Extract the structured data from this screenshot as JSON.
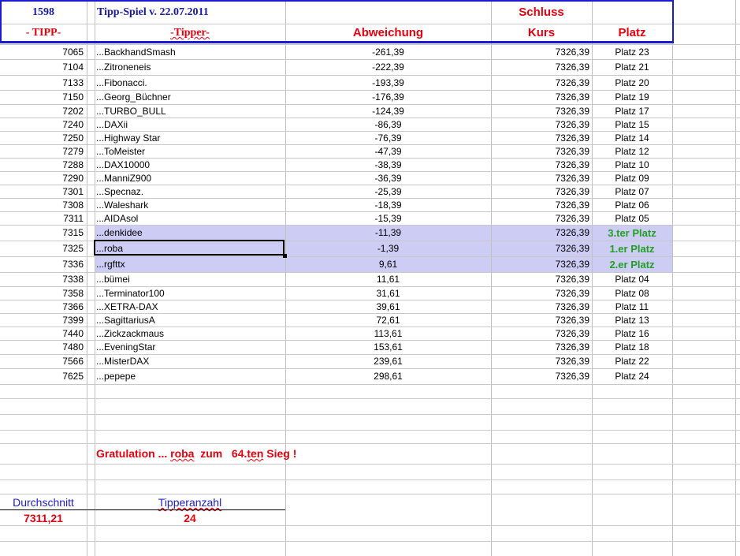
{
  "header": {
    "count": "1598",
    "title": "Tipp-Spiel v. 22.07.2011",
    "schluss": "Schluss",
    "col_tipp": "- TIPP-",
    "col_tipper": "-Tipper-",
    "col_abweichung": "Abweichung",
    "col_kurs": "Kurs",
    "col_platz": "Platz"
  },
  "rows": [
    {
      "tipp": "7065",
      "tipper": "...BackhandSmash",
      "abw": "-261,39",
      "kurs": "7326,39",
      "platz": "Platz 23"
    },
    {
      "tipp": "7104",
      "tipper": "...Zitroneneis",
      "abw": "-222,39",
      "kurs": "7326,39",
      "platz": "Platz 21"
    },
    {
      "tipp": "7133",
      "tipper": "...Fibonacci.",
      "abw": "-193,39",
      "kurs": "7326,39",
      "platz": "Platz 20"
    },
    {
      "tipp": "7150",
      "tipper": "...Georg_Büchner",
      "abw": "-176,39",
      "kurs": "7326,39",
      "platz": "Platz 19"
    },
    {
      "tipp": "7202",
      "tipper": "...TURBO_BULL",
      "abw": "-124,39",
      "kurs": "7326,39",
      "platz": "Platz 17"
    },
    {
      "tipp": "7240",
      "tipper": "...DAXii",
      "abw": "-86,39",
      "kurs": "7326,39",
      "platz": "Platz 15"
    },
    {
      "tipp": "7250",
      "tipper": "...Highway Star",
      "abw": "-76,39",
      "kurs": "7326,39",
      "platz": "Platz 14"
    },
    {
      "tipp": "7279",
      "tipper": "...ToMeister",
      "abw": "-47,39",
      "kurs": "7326,39",
      "platz": "Platz 12"
    },
    {
      "tipp": "7288",
      "tipper": "...DAX10000",
      "abw": "-38,39",
      "kurs": "7326,39",
      "platz": "Platz 10"
    },
    {
      "tipp": "7290",
      "tipper": "...ManniZ900",
      "abw": "-36,39",
      "kurs": "7326,39",
      "platz": "Platz 09"
    },
    {
      "tipp": "7301",
      "tipper": "...Specnaz.",
      "abw": "-25,39",
      "kurs": "7326,39",
      "platz": "Platz 07"
    },
    {
      "tipp": "7308",
      "tipper": "...Waleshark",
      "abw": "-18,39",
      "kurs": "7326,39",
      "platz": "Platz 06"
    },
    {
      "tipp": "7311",
      "tipper": "...AIDAsol",
      "abw": "-15,39",
      "kurs": "7326,39",
      "platz": "Platz 05"
    },
    {
      "tipp": "7315",
      "tipper": "...denkidee",
      "abw": "-11,39",
      "kurs": "7326,39",
      "platz": "3.ter Platz",
      "winner": true
    },
    {
      "tipp": "7325",
      "tipper": "...roba",
      "abw": "-1,39",
      "kurs": "7326,39",
      "platz": "1.er Platz",
      "winner": true
    },
    {
      "tipp": "7336",
      "tipper": "...rgfttx",
      "abw": "9,61",
      "kurs": "7326,39",
      "platz": "2.er Platz",
      "winner": true
    },
    {
      "tipp": "7338",
      "tipper": "...bümei",
      "abw": "11,61",
      "kurs": "7326,39",
      "platz": "Platz 04"
    },
    {
      "tipp": "7358",
      "tipper": "...Terminator100",
      "abw": "31,61",
      "kurs": "7326,39",
      "platz": "Platz 08"
    },
    {
      "tipp": "7366",
      "tipper": "...XETRA-DAX",
      "abw": "39,61",
      "kurs": "7326,39",
      "platz": "Platz 11"
    },
    {
      "tipp": "7399",
      "tipper": "...SagittariusA",
      "abw": "72,61",
      "kurs": "7326,39",
      "platz": "Platz 13"
    },
    {
      "tipp": "7440",
      "tipper": "...Zickzackmaus",
      "abw": "113,61",
      "kurs": "7326,39",
      "platz": "Platz 16"
    },
    {
      "tipp": "7480",
      "tipper": "...EveningStar",
      "abw": "153,61",
      "kurs": "7326,39",
      "platz": "Platz 18"
    },
    {
      "tipp": "7566",
      "tipper": "...MisterDAX",
      "abw": "239,61",
      "kurs": "7326,39",
      "platz": "Platz 22"
    },
    {
      "tipp": "7625",
      "tipper": "...pepepe",
      "abw": "298,61",
      "kurs": "7326,39",
      "platz": "Platz 24"
    }
  ],
  "congrats": {
    "prefix": "Gratulation ... ",
    "name": "roba",
    "mid": "  zum   64.",
    "ten": "ten",
    "suffix": " Sieg !"
  },
  "summary": {
    "avg_label": "Durchschnitt",
    "avg_value": "7311,21",
    "count_label": "Tipperanzahl",
    "count_value": "24"
  },
  "colors": {
    "highlight": "#ccccf5",
    "red": "#e00010",
    "blue": "#1a1aa0",
    "green": "#22a022"
  }
}
